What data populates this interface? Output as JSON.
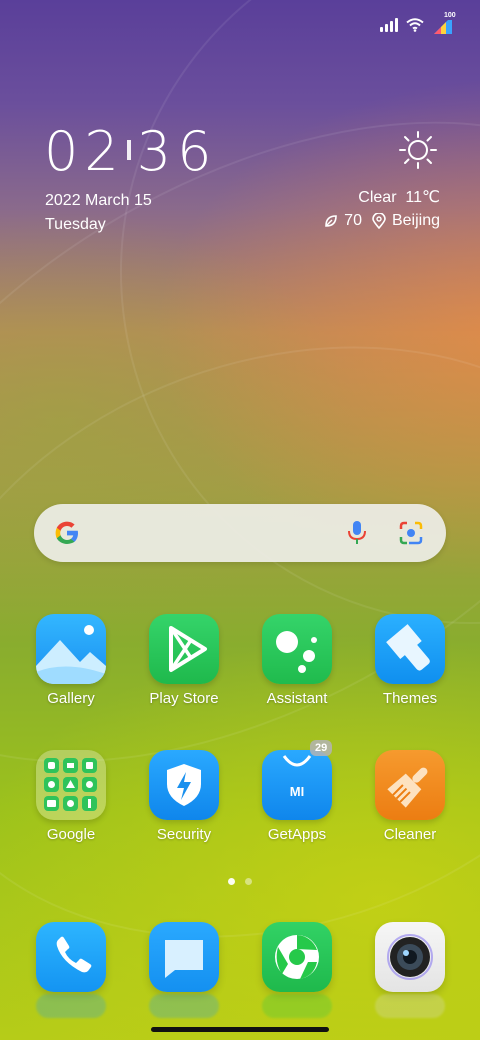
{
  "status_bar": {
    "battery": "100"
  },
  "clock": {
    "hours": "02",
    "minutes": "36"
  },
  "date": {
    "line1": "2022 March 15",
    "line2": "Tuesday"
  },
  "weather": {
    "condition": "Clear",
    "temperature": "11℃",
    "aqi": "70",
    "city": "Beijing",
    "icon": "sun-icon"
  },
  "search": {
    "engine": "google-logo"
  },
  "apps_row1": [
    {
      "label": "Gallery"
    },
    {
      "label": "Play Store"
    },
    {
      "label": "Assistant"
    },
    {
      "label": "Themes"
    }
  ],
  "apps_row2": [
    {
      "label": "Google"
    },
    {
      "label": "Security"
    },
    {
      "label": "GetApps",
      "badge": "29"
    },
    {
      "label": "Cleaner"
    }
  ],
  "getapps_logo_text": "MI",
  "page_indicator": {
    "pages": 2,
    "current": 1
  },
  "dock": [
    {
      "icon": "phone-icon"
    },
    {
      "icon": "messages-icon"
    },
    {
      "icon": "browser-icon"
    },
    {
      "icon": "camera-icon"
    }
  ],
  "colors": {
    "accent_blue": "#1a9cf5",
    "accent_green": "#26c94a",
    "cleaner_orange": "#f08a1e"
  }
}
